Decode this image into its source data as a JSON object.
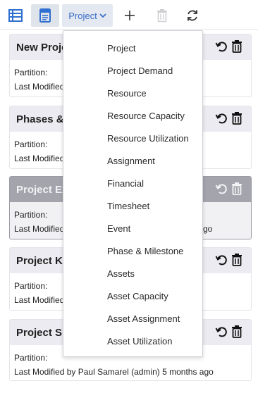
{
  "toolbar": {
    "project_label": "Project",
    "icons": [
      "list-view-icon",
      "document-icon",
      "chevron-down-icon",
      "plus-icon",
      "trash-icon",
      "refresh-icon"
    ]
  },
  "cards": [
    {
      "title": "New Proje",
      "partition_label": "Partition:",
      "modified_label": "Last Modified"
    },
    {
      "title": "Phases & M",
      "partition_label": "Partition:",
      "modified_label": "Last Modified"
    },
    {
      "title": "Project Exp",
      "partition_label": "Partition:",
      "modified_label": "Last Modified",
      "modified_suffix": "go"
    },
    {
      "title": "Project Kp",
      "partition_label": "Partition:",
      "modified_label": "Last Modified"
    },
    {
      "title": "Project Sir",
      "partition_label": "Partition:",
      "modified_label": "Last Modified by Paul Samarel (admin) 5 months ago"
    }
  ],
  "dropdown": {
    "items": [
      "Project",
      "Project Demand",
      "Resource",
      "Resource Capacity",
      "Resource Utilization",
      "Assignment",
      "Financial",
      "Timesheet",
      "Event",
      "Phase & Milestone",
      "Assets",
      "Asset Capacity",
      "Asset Assignment",
      "Asset Utilization"
    ]
  },
  "colors": {
    "accent": "#3a6ec9",
    "card_header": "#ebebf1",
    "selected_header": "#a4a4ad"
  }
}
